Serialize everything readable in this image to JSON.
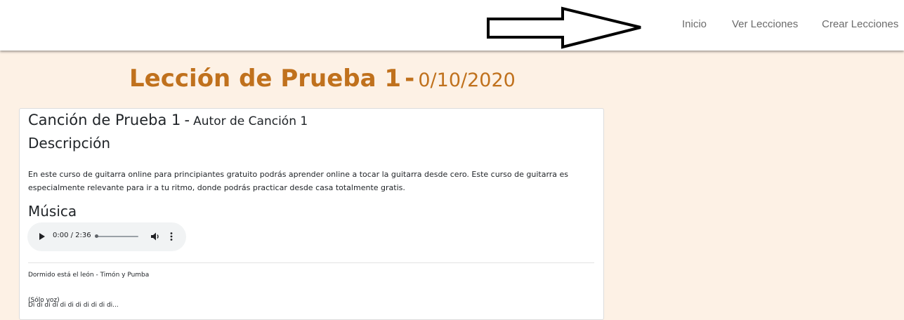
{
  "nav": {
    "links": [
      "Inicio",
      "Ver Lecciones",
      "Crear Lecciones"
    ]
  },
  "lesson": {
    "title": "Lección de Prueba 1",
    "separator": "-",
    "date": "0/10/2020"
  },
  "song": {
    "title": "Canción de Prueba 1",
    "separator": "-",
    "author": "Autor de Canción 1",
    "description_heading": "Descripción",
    "description": "En este curso de guitarra online para principiantes gratuito podrás aprender online a tocar la guitarra desde cero. Este curso de guitarra es especialmente relevante para ir a tu ritmo, donde podrás practicar desde casa totalmente gratis.",
    "music_heading": "Música",
    "player": {
      "time": "0:00 / 2:36",
      "progress": 0
    },
    "lyrics_title": "Dormido está el león - Timón y Pumba",
    "lyrics_note": "(Sólo voz)",
    "lyrics_first_line": "Di di di di di di di di di di di..."
  },
  "colors": {
    "accent": "#c0711d",
    "background": "#fdf1e5"
  },
  "icons": {
    "annotation": "arrow-right-outline-icon",
    "play": "play-icon",
    "volume": "volume-icon",
    "more": "more-vertical-icon"
  }
}
